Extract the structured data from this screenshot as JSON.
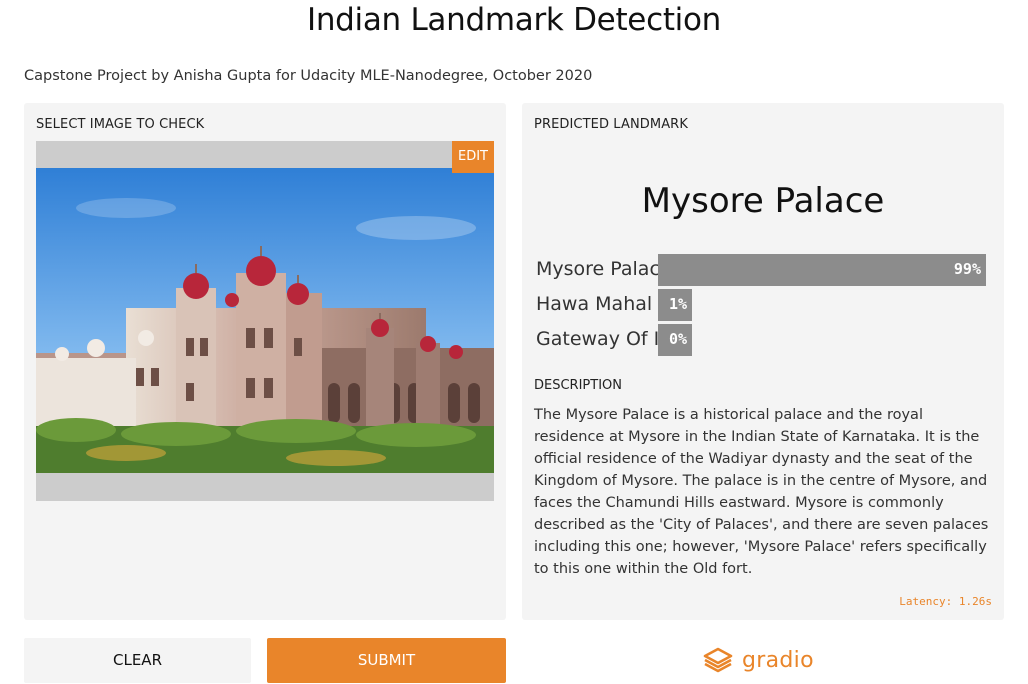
{
  "header": {
    "title": "Indian Landmark Detection",
    "subtitle": "Capstone Project by Anisha Gupta for Udacity MLE-Nanodegree, October 2020"
  },
  "input_panel": {
    "label": "SELECT IMAGE TO CHECK",
    "edit_label": "EDIT"
  },
  "output_panel": {
    "label": "PREDICTED LANDMARK",
    "predicted": "Mysore Palace",
    "confidences": [
      {
        "name": "Mysore Palace",
        "value": "99%",
        "fraction": 0.99
      },
      {
        "name": "Hawa Mahal",
        "value": "1%",
        "fraction": 0.01
      },
      {
        "name": "Gateway Of India",
        "value": "0%",
        "fraction": 0.0
      }
    ],
    "description_label": "DESCRIPTION",
    "description": "The Mysore Palace is a historical palace and the royal residence at Mysore in the Indian State of Karnataka. It is the official residence of the Wadiyar dynasty and the seat of the Kingdom of Mysore. The palace is in the centre of Mysore, and faces the Chamundi Hills eastward. Mysore is commonly described as the 'City of Palaces', and there are seven palaces including this one; however, 'Mysore Palace' refers specifically to this one within the Old fort.",
    "latency": "Latency: 1.26s"
  },
  "actions": {
    "clear_label": "CLEAR",
    "submit_label": "SUBMIT"
  },
  "footer": {
    "brand": "gradio"
  },
  "colors": {
    "accent": "#e9852a",
    "panel_bg": "#f4f4f4",
    "bar": "#8c8c8c"
  }
}
